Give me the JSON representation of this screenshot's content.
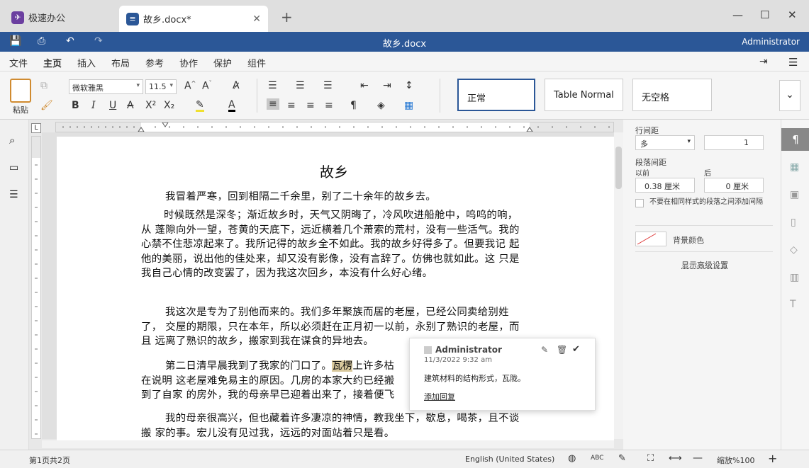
{
  "tabs": {
    "home_label": "极速办公",
    "doc_label": "故乡.docx*",
    "new_tab": "+"
  },
  "titlebar": {
    "title": "故乡.docx",
    "user": "Administrator"
  },
  "menu": [
    "文件",
    "主页",
    "插入",
    "布局",
    "参考",
    "协作",
    "保护",
    "组件"
  ],
  "ribbon": {
    "paste_label": "粘贴",
    "font_name": "微软雅黑",
    "font_size": "11.5",
    "styles": [
      "正常",
      "Table Normal",
      "无空格"
    ]
  },
  "document": {
    "title": "故乡",
    "paragraphs": [
      "我冒着严寒，回到相隔二千余里，别了二十余年的故乡去。",
      "时候既然是深冬；渐近故乡时，天气又阴晦了，冷风吹进船舱中，呜呜的响，从 蓬隙向外一望，苍黄的天底下，远近横着几个萧索的荒村，没有一些活气。我的 心禁不住悲凉起来了。我所记得的故乡全不如此。我的故乡好得多了。但要我记 起他的美丽，说出他的佳处来，却又没有影像，没有言辞了。仿佛也就如此。这 只是我自己心情的改变罢了，因为我这次回乡，本没有什么好心绪。",
      "我这次是专为了别他而来的。我们多年聚族而居的老屋，已经公同卖给别姓了， 交屋的期限，只在本年，所以必须赶在正月初一以前，永别了熟识的老屋，而且 远离了熟识的故乡，搬家到我在谋食的异地去。",
      "我的母亲很高兴，但也藏着许多凄凉的神情，教我坐下，歇息，喝茶，且不谈搬 家的事。宏儿没有见过我，远远的对面站着只是看。"
    ],
    "para4_before": "第二日清早晨我到了我家的门口了。",
    "para4_highlight": "瓦楞",
    "para4_after": "上许多枯",
    "para4_line2": "在说明 这老屋难免易主的原因。几房的本家大约已经搬",
    "para4_line3": "到了自家 的房外，我的母亲早已迎着出来了，接着便飞"
  },
  "comment": {
    "author": "Administrator",
    "date": "11/3/2022 9:32 am",
    "text": "建筑材料的结构形式，瓦陇。",
    "reply": "添加回复"
  },
  "panel": {
    "line_spacing_label": "行间距",
    "line_spacing_mode": "多",
    "line_spacing_value": "1",
    "para_spacing_label": "段落间距",
    "before_label": "以前",
    "after_label": "后",
    "before_value": "0.38 厘米",
    "after_value": "0 厘米",
    "checkbox_label": "不要在相同样式的段落之间添加间隔",
    "bg_color_label": "背景颜色",
    "advanced_link": "显示高级设置"
  },
  "status": {
    "page_info": "第1页共2页",
    "language": "English (United States)",
    "zoom": "缩放%100"
  },
  "colors": {
    "brand": "#2b5797",
    "highlight": "#d8c89c"
  }
}
